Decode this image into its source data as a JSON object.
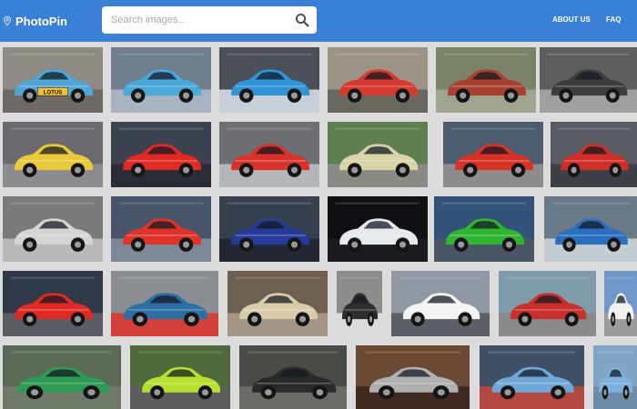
{
  "app": {
    "name": "PhotoPin"
  },
  "search": {
    "placeholder": "Search images..."
  },
  "nav": {
    "about": "ABOUT US",
    "faq": "FAQ"
  },
  "colors": {
    "header": "#3a80d6",
    "background": "#dcdcdc"
  },
  "icons": {
    "logo": "map-pin-icon",
    "search": "search-icon"
  },
  "photos": [
    {
      "bg": "#8f8a84",
      "floor": "#6e6964",
      "car": "#4fa6d9",
      "tag": "LOTUS"
    },
    {
      "bg": "#6f7e8c",
      "floor": "#a7b3be",
      "car": "#4aa8dc"
    },
    {
      "bg": "#4a4f58",
      "floor": "#c9cfd6",
      "car": "#2f95d6"
    },
    {
      "bg": "#9b9386",
      "floor": "#6a6660",
      "car": "#d63a2f"
    },
    {
      "bg": "#7a8268",
      "floor": "#9fa58e",
      "car": "#a8402f"
    },
    {
      "bg": "#5e5e5e",
      "floor": "#a0a0a0",
      "car": "#3c3c3c"
    },
    {
      "bg": "#6a6a70",
      "floor": "#8b8b90",
      "car": "#e8c93a"
    },
    {
      "bg": "#3d4250",
      "floor": "#2a2d35",
      "car": "#e02a24"
    },
    {
      "bg": "#6d6f72",
      "floor": "#b4b7ba",
      "car": "#d9322a"
    },
    {
      "bg": "#5f7e52",
      "floor": "#8a8a84",
      "car": "#d9d3a8"
    },
    {
      "bg": "#4c5c6c",
      "floor": "#8c8c8c",
      "car": "#d83126"
    },
    {
      "bg": "#5a5c64",
      "floor": "#3e4048",
      "car": "#d12e27"
    },
    {
      "bg": "#7a7a7a",
      "floor": "#b9b9b9",
      "car": "#d4d4d4"
    },
    {
      "bg": "#47546a",
      "floor": "#7d8898",
      "car": "#e0342a"
    },
    {
      "bg": "#37404e",
      "floor": "#222731",
      "car": "#243b99"
    },
    {
      "bg": "#0f1014",
      "floor": "#1a1b20",
      "car": "#e5e8ec"
    },
    {
      "bg": "#33527a",
      "floor": "#4a5565",
      "car": "#2fb52f"
    },
    {
      "bg": "#6a7a86",
      "floor": "#c5ccd2",
      "car": "#2b6fc0"
    },
    {
      "bg": "#2f3947",
      "floor": "#5a5d63",
      "car": "#e02a24"
    },
    {
      "bg": "#8a8e92",
      "floor": "#d4413a",
      "car": "#2c6fa4"
    },
    {
      "bg": "#6e6050",
      "floor": "#a39686",
      "car": "#d8ccaa"
    },
    {
      "bg": "#8c8c8c",
      "floor": "#dcdcdc",
      "car": "#2e2e2e"
    },
    {
      "bg": "#9098a3",
      "floor": "#5b5f66",
      "car": "#f4f4f4"
    },
    {
      "bg": "#7f9aa8",
      "floor": "#8a8a8a",
      "car": "#c9302c"
    },
    {
      "bg": "#6f97c9",
      "floor": "#9c9c9c",
      "car": "#f0f0f0"
    },
    {
      "bg": "#5a6a55",
      "floor": "#6f7a6a",
      "car": "#2e9a55"
    },
    {
      "bg": "#4f6a3c",
      "floor": "#5d5d5d",
      "car": "#b7e02e"
    },
    {
      "bg": "#4a4a46",
      "floor": "#6c6c66",
      "car": "#2a2a28"
    },
    {
      "bg": "#6b4a35",
      "floor": "#3e2a20",
      "car": "#b0b0b0"
    },
    {
      "bg": "#3f5066",
      "floor": "#b24840",
      "car": "#6fa8d8"
    },
    {
      "bg": "#84a4c4",
      "floor": "#6f8aa6",
      "car": "#7bb3de"
    }
  ]
}
